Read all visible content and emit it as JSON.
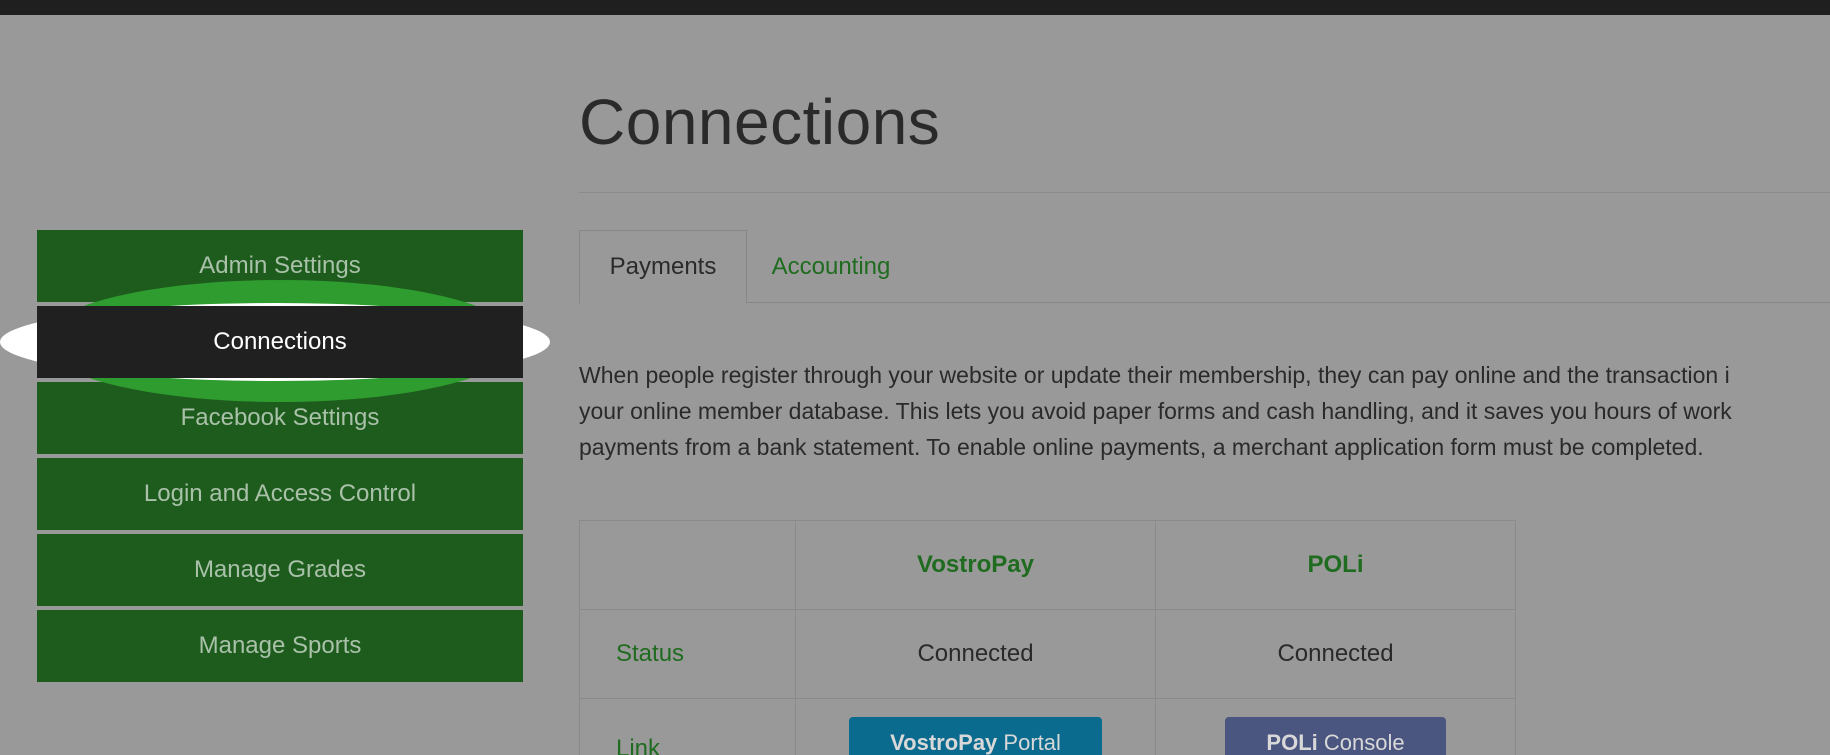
{
  "sidebar": {
    "items": [
      {
        "label": "Admin Settings"
      },
      {
        "label": "Connections"
      },
      {
        "label": "Facebook Settings"
      },
      {
        "label": "Login and Access Control"
      },
      {
        "label": "Manage Grades"
      },
      {
        "label": "Manage Sports"
      }
    ],
    "active_index": 1
  },
  "page": {
    "title": "Connections"
  },
  "tabs": [
    {
      "label": "Payments",
      "active": true
    },
    {
      "label": "Accounting",
      "active": false
    }
  ],
  "description": {
    "line1": "When people register through your website or update their membership, they can pay online and the transaction i",
    "line2": "your online member database. This lets you avoid paper forms and cash handling, and it saves you hours of work",
    "line3": "payments from a bank statement. To enable online payments, a merchant application form must be completed."
  },
  "payments_table": {
    "columns": [
      "",
      "VostroPay",
      "POLi"
    ],
    "rows": [
      {
        "label": "Status",
        "vostropay": "Connected",
        "poli": "Connected"
      },
      {
        "label": "Link"
      }
    ],
    "buttons": {
      "vostropay_bold": "VostroPay",
      "vostropay_rest": " Portal",
      "poli_bold": "POLi",
      "poli_rest": " Console"
    }
  },
  "colors": {
    "sidebar_bg": "#1e5c1e",
    "active_item_bg": "#202020",
    "link_green": "#1f6b1f",
    "vostropay_button": "#0a6b8f",
    "poli_button": "#4a5680"
  }
}
